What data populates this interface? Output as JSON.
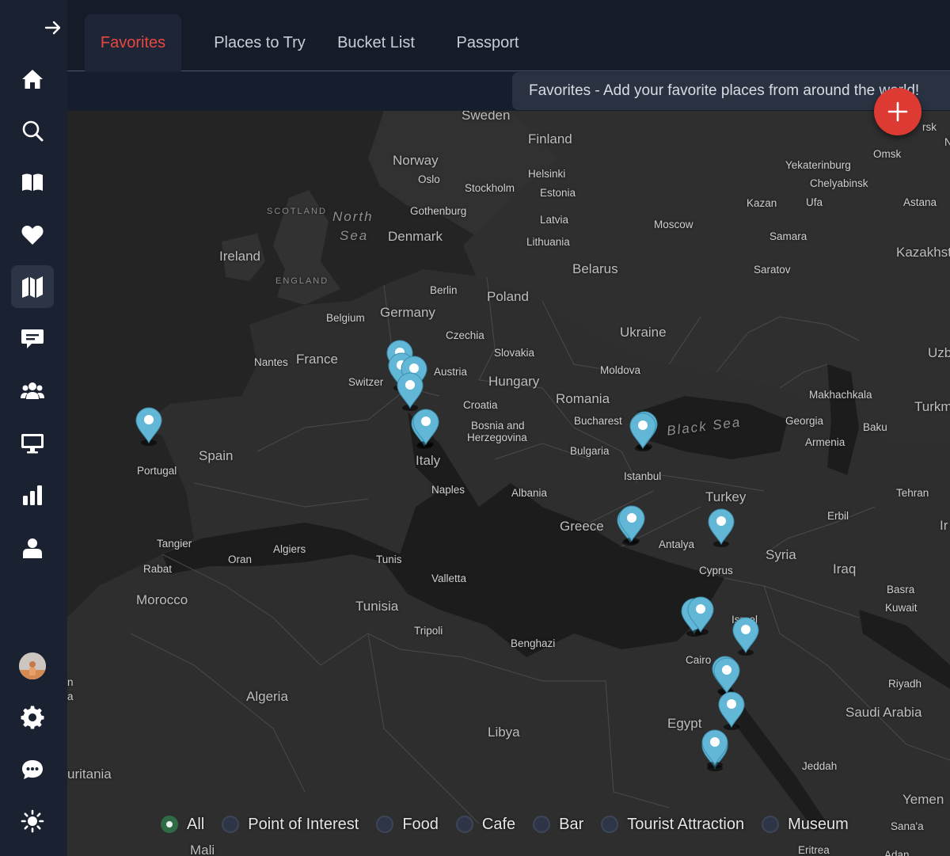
{
  "tabs": [
    {
      "label": "Favorites",
      "active": true
    },
    {
      "label": "Places to Try",
      "active": false
    },
    {
      "label": "Bucket List",
      "active": false
    },
    {
      "label": "Passport",
      "active": false
    }
  ],
  "banner": {
    "text": "Favorites - Add your favorite places from around the world!"
  },
  "colors": {
    "accent": "#e8473f",
    "pin": "#62b6d6",
    "fab": "#de3a34",
    "filter_selected": "#2f6b45"
  },
  "sidebar": {
    "collapse_icon": "arrow-right-icon",
    "items": [
      {
        "icon": "home-icon"
      },
      {
        "icon": "search-icon"
      },
      {
        "icon": "book-open-icon"
      },
      {
        "icon": "heart-icon"
      },
      {
        "icon": "map-icon",
        "active": true
      },
      {
        "icon": "comment-icon"
      },
      {
        "icon": "users-icon"
      },
      {
        "icon": "desktop-icon"
      },
      {
        "icon": "bar-chart-icon"
      },
      {
        "icon": "user-icon"
      }
    ],
    "bottom": [
      {
        "icon": "avatar"
      },
      {
        "icon": "gear-icon"
      },
      {
        "icon": "chat-icon"
      },
      {
        "icon": "sun-icon"
      }
    ]
  },
  "map": {
    "labels": [
      {
        "text": "Sweden",
        "type": "country"
      },
      {
        "text": "Finland",
        "type": "country"
      },
      {
        "text": "Norway",
        "type": "country"
      },
      {
        "text": "Oslo",
        "type": "city"
      },
      {
        "text": "Helsinki",
        "type": "city"
      },
      {
        "text": "Stockholm",
        "type": "city"
      },
      {
        "text": "Estonia",
        "type": "city"
      },
      {
        "text": "SCOTLAND",
        "type": "region"
      },
      {
        "text": "North",
        "type": "sea"
      },
      {
        "text": "Sea",
        "type": "sea"
      },
      {
        "text": "Gothenburg",
        "type": "city"
      },
      {
        "text": "Latvia",
        "type": "city"
      },
      {
        "text": "Denmark",
        "type": "country"
      },
      {
        "text": "Lithuania",
        "type": "city"
      },
      {
        "text": "Moscow",
        "type": "city"
      },
      {
        "text": "Yekaterinburg",
        "type": "city"
      },
      {
        "text": "Chelyabinsk",
        "type": "city"
      },
      {
        "text": "Omsk",
        "type": "city"
      },
      {
        "text": "Kazan",
        "type": "city"
      },
      {
        "text": "Ufa",
        "type": "city"
      },
      {
        "text": "Astana",
        "type": "city"
      },
      {
        "text": "Samara",
        "type": "city"
      },
      {
        "text": "Saratov",
        "type": "city"
      },
      {
        "text": "Kazakhst",
        "type": "country"
      },
      {
        "text": "Ireland",
        "type": "country"
      },
      {
        "text": "ENGLAND",
        "type": "region"
      },
      {
        "text": "Belarus",
        "type": "country"
      },
      {
        "text": "Berlin",
        "type": "city"
      },
      {
        "text": "Poland",
        "type": "country"
      },
      {
        "text": "Germany",
        "type": "country"
      },
      {
        "text": "Belgium",
        "type": "city"
      },
      {
        "text": "Ukraine",
        "type": "country"
      },
      {
        "text": "Czechia",
        "type": "city"
      },
      {
        "text": "Slovakia",
        "type": "city"
      },
      {
        "text": "Nantes",
        "type": "city"
      },
      {
        "text": "France",
        "type": "country"
      },
      {
        "text": "Austria",
        "type": "city"
      },
      {
        "text": "Moldova",
        "type": "city"
      },
      {
        "text": "Switzer",
        "type": "city"
      },
      {
        "text": "Hungary",
        "type": "country"
      },
      {
        "text": "Romania",
        "type": "country"
      },
      {
        "text": "Croatia",
        "type": "city"
      },
      {
        "text": "Bosnia and",
        "type": "city"
      },
      {
        "text": "Herzegovina",
        "type": "city"
      },
      {
        "text": "Bucharest",
        "type": "city"
      },
      {
        "text": "Black Sea",
        "type": "sea"
      },
      {
        "text": "Georgia",
        "type": "city"
      },
      {
        "text": "Armenia",
        "type": "city"
      },
      {
        "text": "Baku",
        "type": "city"
      },
      {
        "text": "Makhachkala",
        "type": "city"
      },
      {
        "text": "Turkm",
        "type": "country"
      },
      {
        "text": "Uzb",
        "type": "country"
      },
      {
        "text": "Portugal",
        "type": "city"
      },
      {
        "text": "Spain",
        "type": "country"
      },
      {
        "text": "Italy",
        "type": "country"
      },
      {
        "text": "Bulgaria",
        "type": "city"
      },
      {
        "text": "Istanbul",
        "type": "city"
      },
      {
        "text": "Naples",
        "type": "city"
      },
      {
        "text": "Albania",
        "type": "city"
      },
      {
        "text": "Turkey",
        "type": "country"
      },
      {
        "text": "Tehran",
        "type": "city"
      },
      {
        "text": "Greece",
        "type": "country"
      },
      {
        "text": "Antalya",
        "type": "city"
      },
      {
        "text": "Erbil",
        "type": "city"
      },
      {
        "text": "Tangier",
        "type": "city"
      },
      {
        "text": "Algiers",
        "type": "city"
      },
      {
        "text": "Oran",
        "type": "city"
      },
      {
        "text": "Tunis",
        "type": "city"
      },
      {
        "text": "Rabat",
        "type": "city"
      },
      {
        "text": "Syria",
        "type": "country"
      },
      {
        "text": "Cyprus",
        "type": "city"
      },
      {
        "text": "Iraq",
        "type": "country"
      },
      {
        "text": "Valletta",
        "type": "city"
      },
      {
        "text": "Morocco",
        "type": "country"
      },
      {
        "text": "Tunisia",
        "type": "country"
      },
      {
        "text": "Basra",
        "type": "city"
      },
      {
        "text": "Kuwait",
        "type": "city"
      },
      {
        "text": "Israel",
        "type": "city"
      },
      {
        "text": "Tripoli",
        "type": "city"
      },
      {
        "text": "Benghazi",
        "type": "city"
      },
      {
        "text": "Cairo",
        "type": "city"
      },
      {
        "text": "Riyadh",
        "type": "city"
      },
      {
        "text": "Algeria",
        "type": "country"
      },
      {
        "text": "Saudi Arabia",
        "type": "country"
      },
      {
        "text": "Egypt",
        "type": "country"
      },
      {
        "text": "Libya",
        "type": "country"
      },
      {
        "text": "Jeddah",
        "type": "city"
      },
      {
        "text": "uritania",
        "type": "country"
      },
      {
        "text": "Yemen",
        "type": "country"
      },
      {
        "text": "Sana'a",
        "type": "city"
      },
      {
        "text": "Mali",
        "type": "country"
      },
      {
        "text": "Eritrea",
        "type": "city"
      },
      {
        "text": "Ir",
        "type": "country"
      },
      {
        "text": "n",
        "type": "city"
      },
      {
        "text": "a",
        "type": "city"
      },
      {
        "text": "rsk",
        "type": "city"
      },
      {
        "text": "N",
        "type": "city"
      },
      {
        "text": "Adan",
        "type": "city"
      }
    ],
    "pins_count": 20
  },
  "filters": [
    {
      "label": "All",
      "selected": true
    },
    {
      "label": "Point of Interest",
      "selected": false
    },
    {
      "label": "Food",
      "selected": false
    },
    {
      "label": "Cafe",
      "selected": false
    },
    {
      "label": "Bar",
      "selected": false
    },
    {
      "label": "Tourist Attraction",
      "selected": false
    },
    {
      "label": "Museum",
      "selected": false
    }
  ]
}
